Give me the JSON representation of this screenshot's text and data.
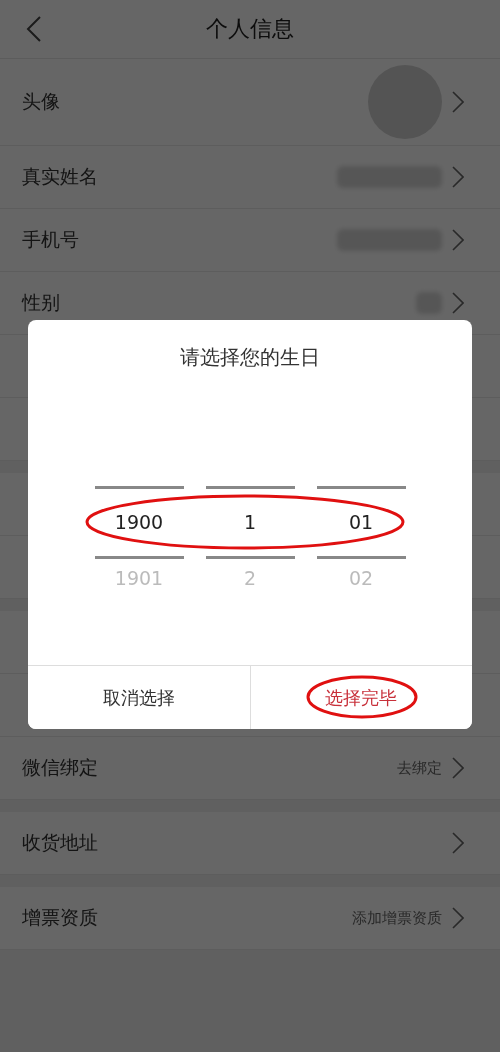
{
  "header": {
    "back": true,
    "title": "个人信息"
  },
  "sections": [
    {
      "rows": [
        {
          "kind": "avatar",
          "label": "头像"
        },
        {
          "kind": "blurred",
          "label": "真实姓名"
        },
        {
          "kind": "blurred",
          "label": "手机号"
        },
        {
          "kind": "blurred_short",
          "label": "性别"
        },
        {
          "kind": "hidden"
        },
        {
          "kind": "hidden"
        }
      ]
    },
    {
      "rows": [
        {
          "kind": "hidden"
        },
        {
          "kind": "hidden"
        }
      ]
    },
    {
      "rows": [
        {
          "kind": "hidden"
        },
        {
          "kind": "hidden"
        },
        {
          "kind": "text",
          "label": "微信绑定",
          "value": "去绑定"
        }
      ]
    },
    {
      "rows": [
        {
          "kind": "text",
          "label": "收货地址"
        }
      ]
    },
    {
      "rows": [
        {
          "kind": "text",
          "label": "增票资质",
          "value": "添加增票资质"
        }
      ]
    }
  ],
  "dialog": {
    "title": "请选择您的生日",
    "columns": [
      {
        "items": [
          {
            "label": "1900",
            "selected": true
          },
          {
            "label": "1901",
            "selected": false
          }
        ]
      },
      {
        "items": [
          {
            "label": "1",
            "selected": true
          },
          {
            "label": "2",
            "selected": false
          }
        ]
      },
      {
        "items": [
          {
            "label": "01",
            "selected": true
          },
          {
            "label": "02",
            "selected": false
          }
        ]
      }
    ],
    "selection_circled": true,
    "buttons": [
      {
        "label": "取消选择",
        "kind": "cancel",
        "circled": false
      },
      {
        "label": "选择完毕",
        "kind": "confirm",
        "circled": true
      }
    ]
  }
}
